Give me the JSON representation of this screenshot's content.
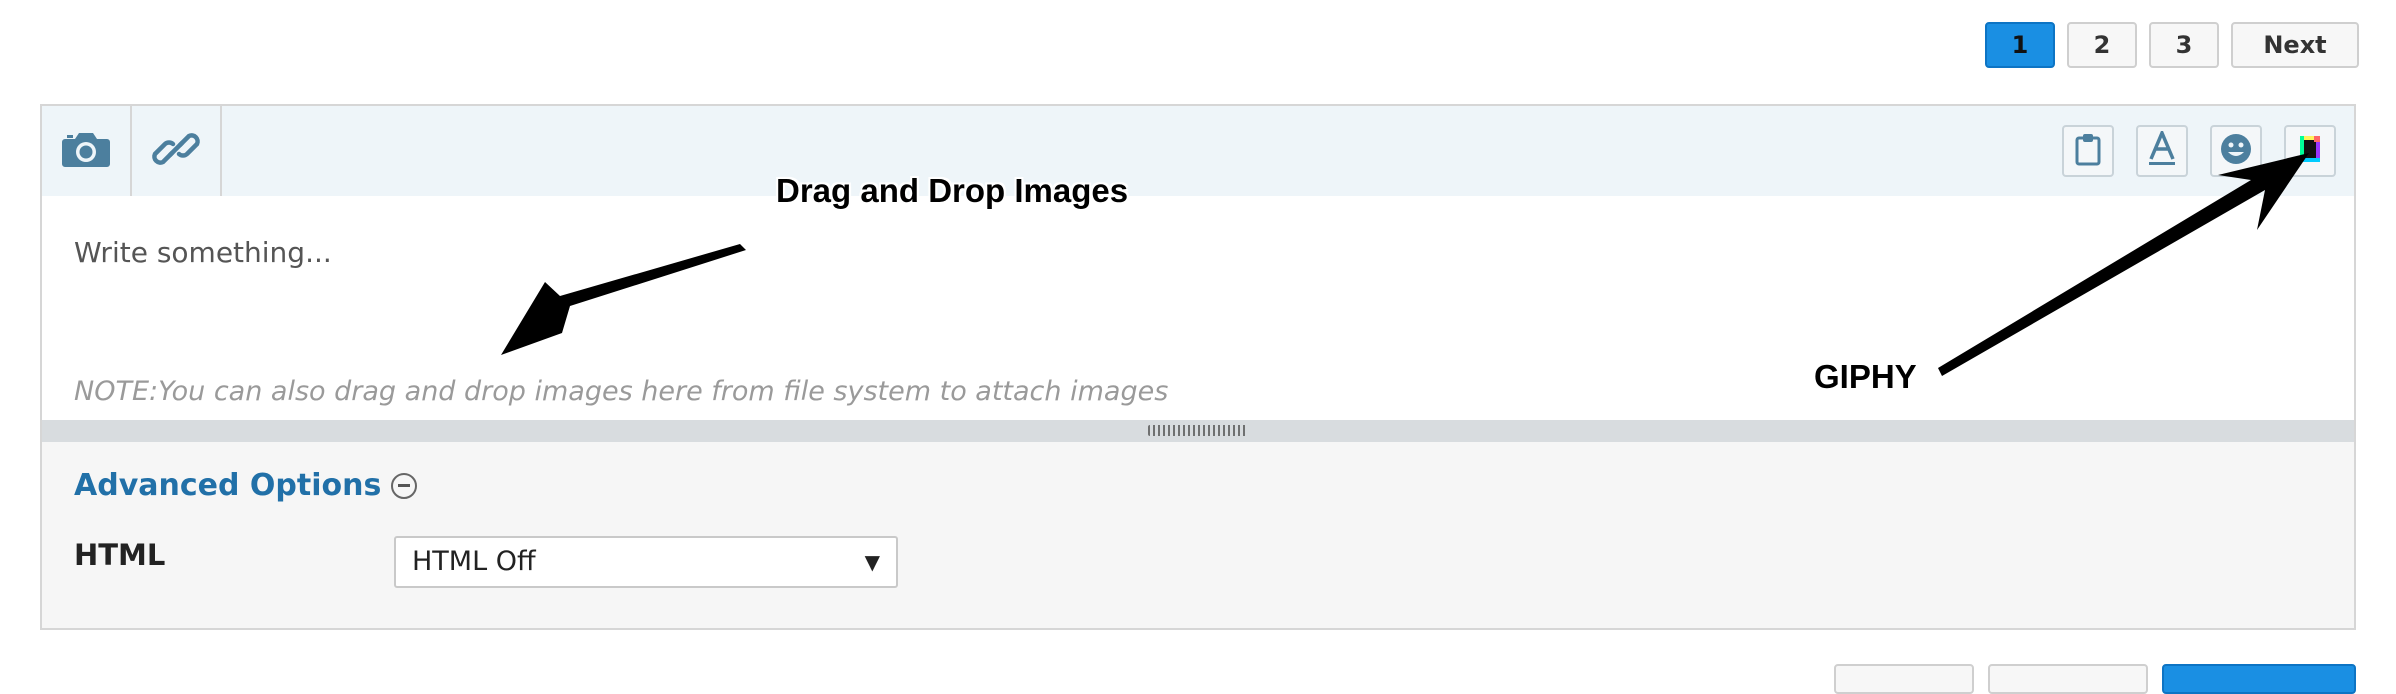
{
  "pagination": {
    "pages": [
      "1",
      "2",
      "3"
    ],
    "active": "1",
    "next_label": "Next"
  },
  "toolbar": {
    "left_icons": [
      "camera-icon",
      "link-icon"
    ],
    "right_icons": [
      "clipboard-icon",
      "font-icon",
      "emoji-icon",
      "giphy-icon"
    ]
  },
  "editor": {
    "placeholder": "Write something...",
    "note": "NOTE:You can also drag and drop images here from file system to attach images"
  },
  "advanced": {
    "title": "Advanced Options",
    "html_label": "HTML",
    "html_value": "HTML Off"
  },
  "annotations": {
    "drag_drop": "Drag and Drop Images",
    "giphy": "GIPHY"
  },
  "colors": {
    "accent": "#1a8fe3",
    "link_blue": "#2170a8",
    "toolbar_bg": "#eef5f9"
  }
}
